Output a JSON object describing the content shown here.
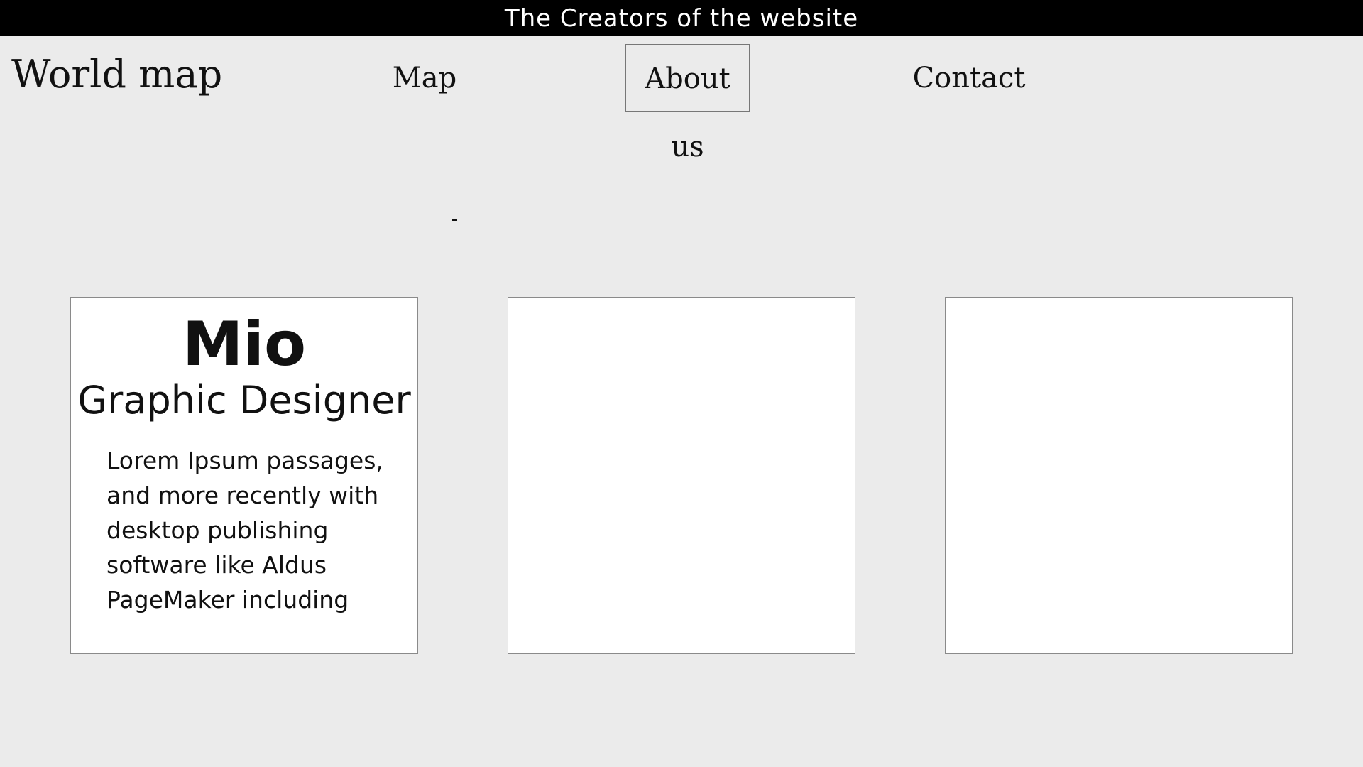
{
  "topbar": {
    "title": "The Creators of the website"
  },
  "header": {
    "logo": "World map"
  },
  "nav": {
    "items": [
      {
        "label": "Map"
      },
      {
        "label": "About us"
      },
      {
        "label": "Contact"
      }
    ]
  },
  "cards": [
    {
      "name": "Mio",
      "role": "Graphic Designer",
      "description": "Lorem Ipsum passages, and more recently with desktop publishing software like Aldus PageMaker including"
    },
    {
      "name": "",
      "role": "",
      "description": ""
    },
    {
      "name": "",
      "role": "",
      "description": ""
    }
  ]
}
